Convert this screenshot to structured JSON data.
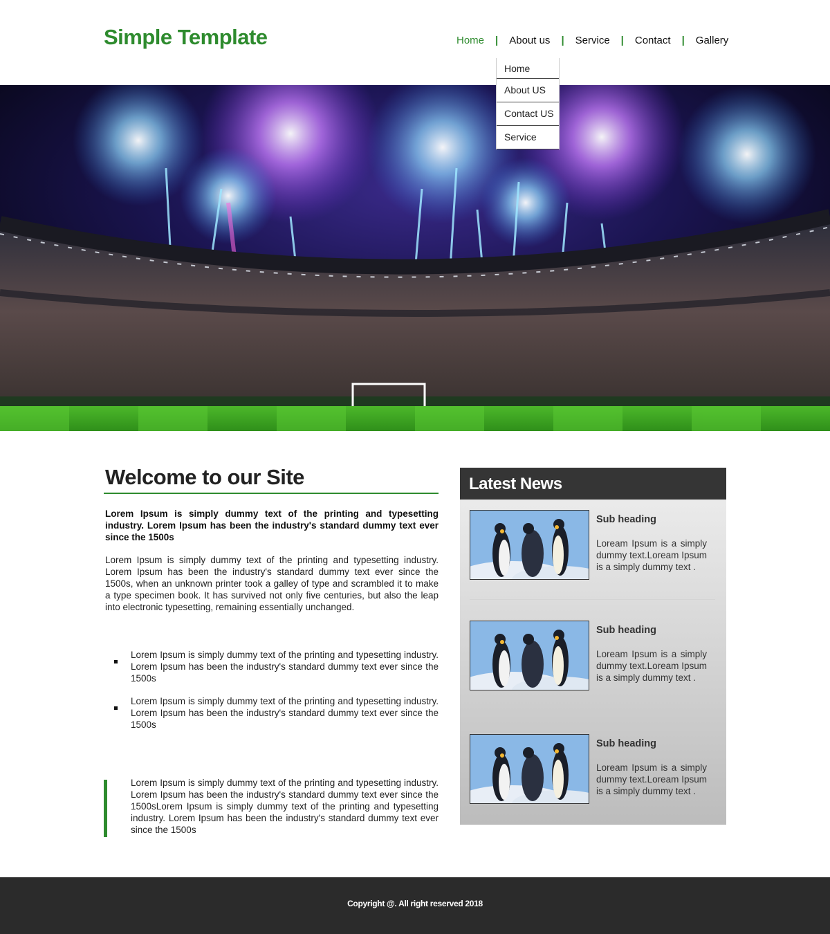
{
  "header": {
    "logo": "Simple Template",
    "nav": [
      {
        "label": "Home",
        "active": true
      },
      {
        "label": "About us",
        "active": false
      },
      {
        "label": "Service",
        "active": false
      },
      {
        "label": "Contact",
        "active": false
      },
      {
        "label": "Gallery",
        "active": false
      }
    ],
    "separator": "|",
    "dropdown": [
      "Home",
      "About US",
      "Contact US",
      "Service"
    ]
  },
  "hero": {
    "image": "stadium-fireworks-image"
  },
  "main": {
    "title": "Welcome to our Site",
    "lead": "Lorem Ipsum is simply dummy text of the printing and typesetting industry. Lorem Ipsum has been the industry's standard dummy text ever since the 1500s",
    "body": "Lorem Ipsum is simply dummy text of the printing and typesetting industry. Lorem Ipsum has been the industry's standard dummy text ever since the 1500s, when an unknown printer took a galley of type and scrambled it to make a type specimen book. It has survived not only five centuries, but also the leap into electronic typesetting, remaining essentially unchanged.",
    "bullets": [
      "Lorem Ipsum is simply dummy text of the printing and typesetting industry. Lorem Ipsum has been the industry's standard dummy text ever since the 1500s",
      "Lorem Ipsum is simply dummy text of the printing and typesetting industry. Lorem Ipsum has been the industry's standard dummy text ever since the 1500s"
    ],
    "quote": "Lorem Ipsum is simply dummy text of the printing and typesetting industry. Lorem Ipsum has been the industry's standard dummy text ever since the 1500sLorem Ipsum is simply dummy text of the printing and typesetting industry. Lorem Ipsum has been the industry's standard dummy text ever since the 1500s"
  },
  "news": {
    "title": "Latest News",
    "items": [
      {
        "heading": "Sub heading",
        "text": "Loream Ipsum is a simply dummy text.Loream Ipsum is a simply dummy text .",
        "image": "penguins-image"
      },
      {
        "heading": "Sub heading",
        "text": "Loream Ipsum is a simply dummy text.Loream Ipsum is a simply dummy text .",
        "image": "penguins-image"
      },
      {
        "heading": "Sub heading",
        "text": "Loream Ipsum is a simply dummy text.Loream Ipsum is a simply dummy text .",
        "image": "penguins-image"
      }
    ]
  },
  "footer": {
    "copyright": "Copyright @. All right reserved 2018"
  },
  "colors": {
    "accent": "#2e8b2e",
    "dark": "#2b2b2b",
    "news_header": "#353535"
  }
}
